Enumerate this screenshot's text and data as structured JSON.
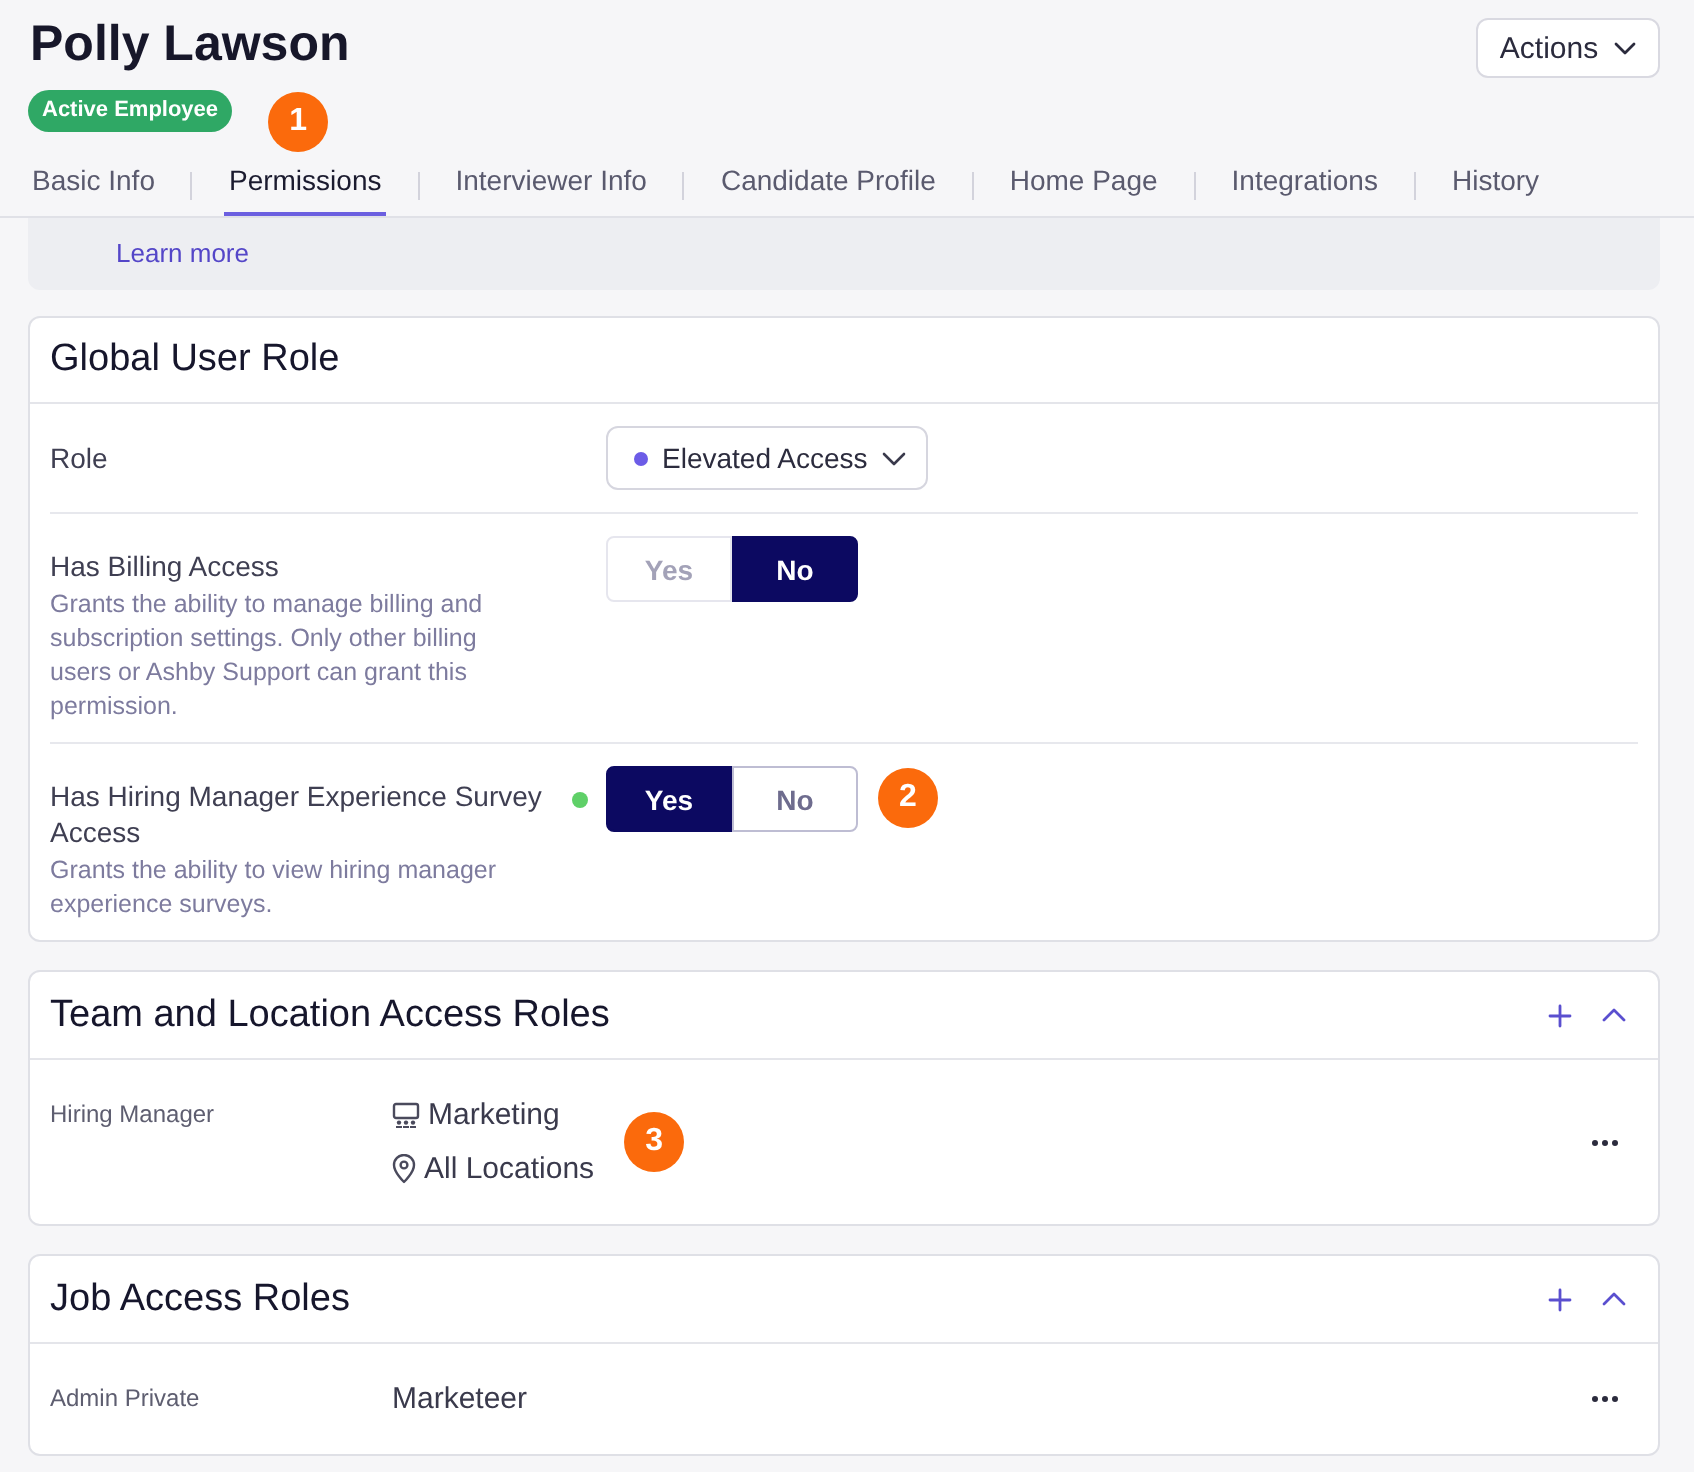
{
  "header": {
    "title": "Polly Lawson",
    "status_badge": "Active Employee",
    "callout": "1",
    "actions_button": "Actions"
  },
  "tabs": [
    {
      "label": "Basic Info",
      "selected": false
    },
    {
      "label": "Permissions",
      "selected": true
    },
    {
      "label": "Interviewer Info",
      "selected": false
    },
    {
      "label": "Candidate Profile",
      "selected": false
    },
    {
      "label": "Home Page",
      "selected": false
    },
    {
      "label": "Integrations",
      "selected": false
    },
    {
      "label": "History",
      "selected": false
    }
  ],
  "info_banner": {
    "link": "Learn more"
  },
  "global_user_role": {
    "title": "Global User Role",
    "rows": [
      {
        "kind": "select",
        "label": "Role",
        "value": "Elevated Access",
        "color": "#6c5ce7"
      },
      {
        "kind": "toggle",
        "label": "Has Billing Access",
        "description": "Grants the ability to manage billing and subscription settings. Only other billing users or Ashby Support can grant this permission.",
        "changed": false,
        "disabled": true,
        "options": [
          {
            "label": "Yes",
            "selected": false
          },
          {
            "label": "No",
            "selected": true
          }
        ]
      },
      {
        "kind": "toggle",
        "label": "Has Hiring Manager Experience Survey Access",
        "description": "Grants the ability to view hiring manager experience surveys.",
        "changed": true,
        "disabled": false,
        "options": [
          {
            "label": "Yes",
            "selected": true
          },
          {
            "label": "No",
            "selected": false
          }
        ],
        "callout": "2"
      }
    ]
  },
  "access_sections": [
    {
      "title": "Team and Location Access Roles",
      "expanded": true,
      "rows": [
        {
          "role": "Hiring Manager",
          "scopes": [
            {
              "kind": "team",
              "text": "Marketing"
            },
            {
              "kind": "location",
              "text": "All Locations"
            }
          ],
          "callout": "3"
        }
      ]
    },
    {
      "title": "Job Access Roles",
      "expanded": true,
      "rows": [
        {
          "role": "Admin Private",
          "scopes": [
            {
              "kind": "job",
              "text": "Marketeer"
            }
          ]
        }
      ]
    }
  ]
}
